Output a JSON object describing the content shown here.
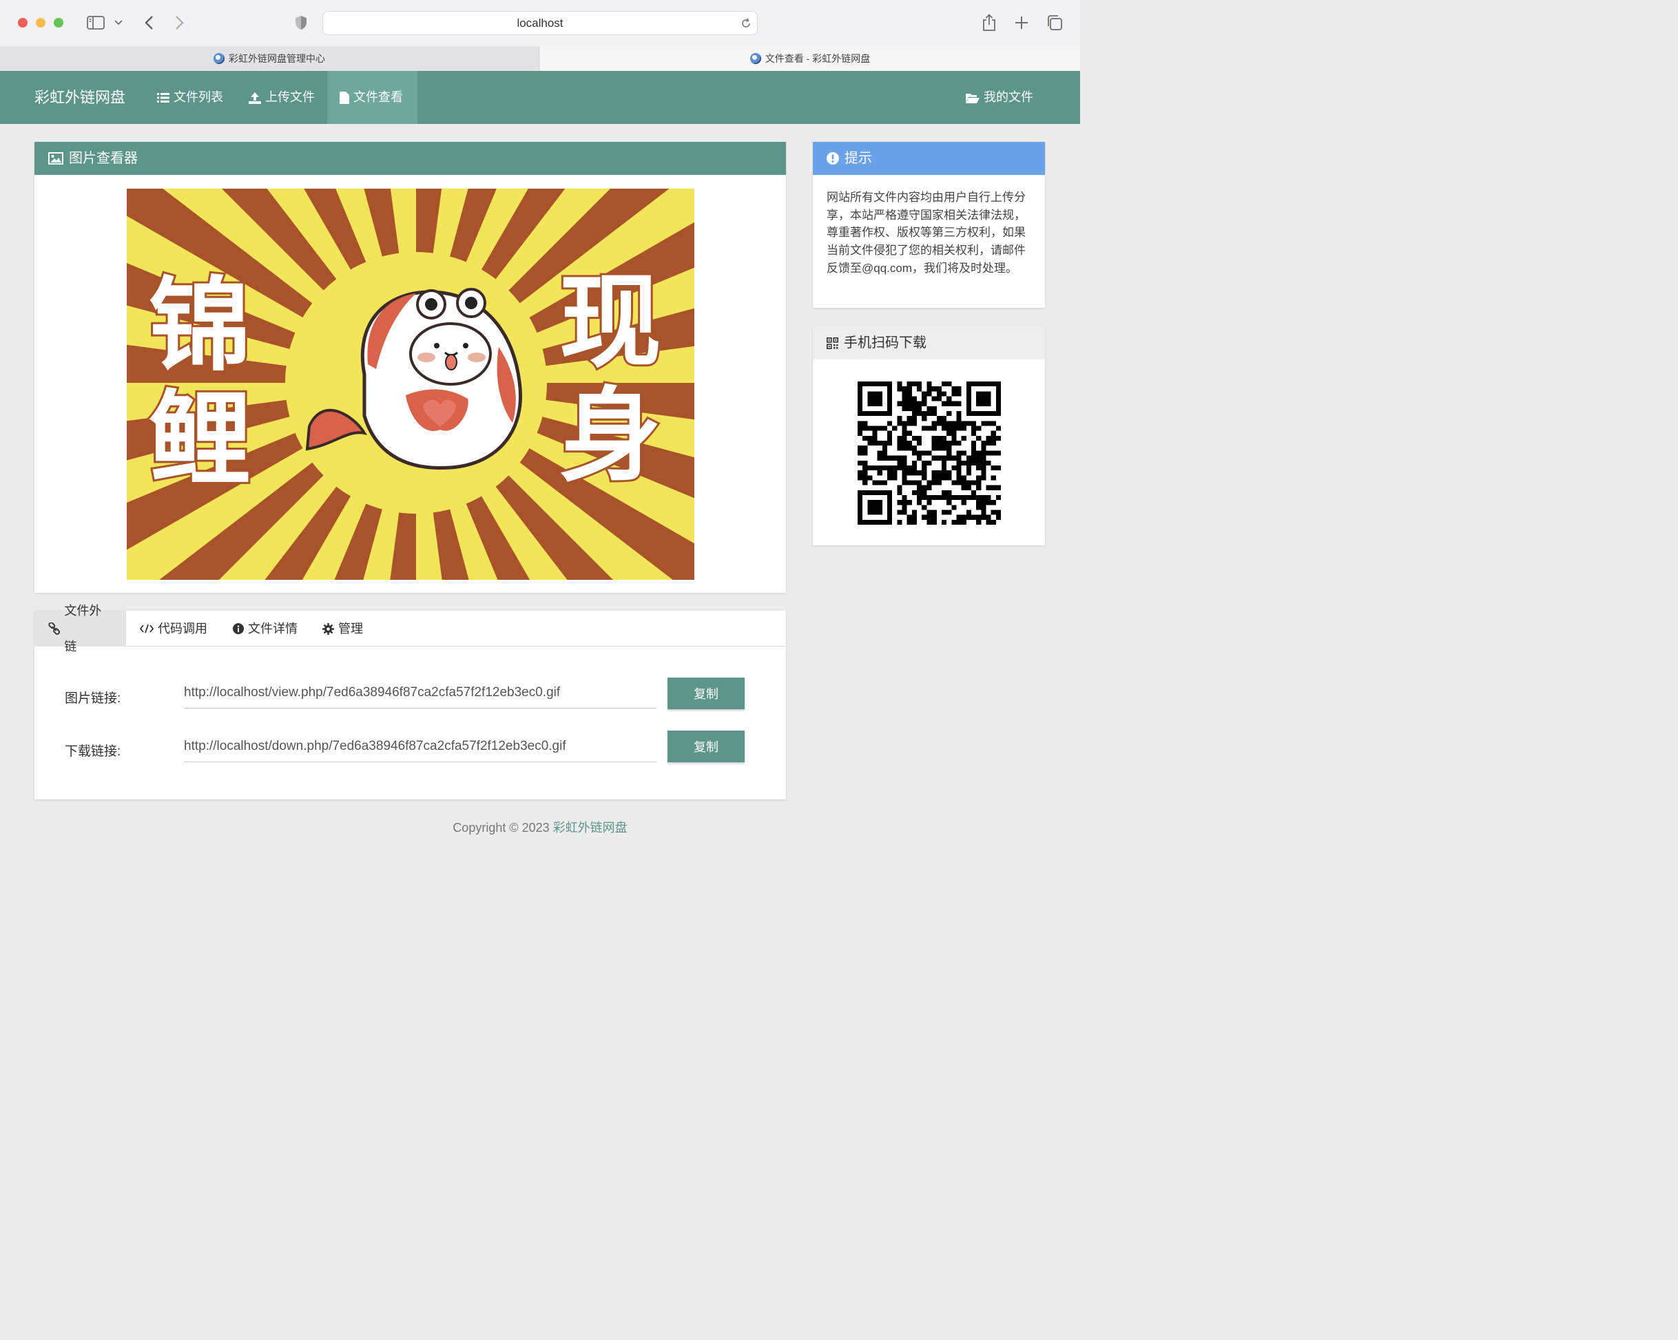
{
  "browser": {
    "url": "localhost",
    "tabs": [
      {
        "title": "彩虹外链网盘管理中心",
        "active": false
      },
      {
        "title": "文件查看 - 彩虹外链网盘",
        "active": true
      }
    ]
  },
  "navbar": {
    "brand": "彩虹外链网盘",
    "items": [
      {
        "label": "文件列表",
        "icon": "list-icon"
      },
      {
        "label": "上传文件",
        "icon": "upload-icon"
      },
      {
        "label": "文件查看",
        "icon": "file-icon",
        "active": true
      }
    ],
    "right_item": {
      "label": "我的文件",
      "icon": "folder-open-icon"
    }
  },
  "viewer": {
    "title": "图片查看器",
    "image": {
      "left_text": [
        "锦",
        "鲤"
      ],
      "right_text": [
        "现",
        "身"
      ]
    }
  },
  "links": {
    "tabs": [
      {
        "label": "文件外链",
        "icon": "link-icon",
        "active": true
      },
      {
        "label": "代码调用",
        "icon": "code-icon"
      },
      {
        "label": "文件详情",
        "icon": "info-icon"
      },
      {
        "label": "管理",
        "icon": "gear-icon"
      }
    ],
    "rows": [
      {
        "label": "图片链接:",
        "value": "http://localhost/view.php/7ed6a38946f87ca2cfa57f2f12eb3ec0.gif",
        "button": "复制"
      },
      {
        "label": "下载链接:",
        "value": "http://localhost/down.php/7ed6a38946f87ca2cfa57f2f12eb3ec0.gif",
        "button": "复制"
      }
    ]
  },
  "tip": {
    "title": "提示",
    "body": "网站所有文件内容均由用户自行上传分享，本站严格遵守国家相关法律法规，尊重著作权、版权等第三方权利，如果当前文件侵犯了您的相关权利，请邮件反馈至@qq.com，我们将及时处理。"
  },
  "qr": {
    "title": "手机扫码下载"
  },
  "footer": {
    "prefix": "Copyright © 2023 ",
    "brand": "彩虹外链网盘"
  },
  "colors": {
    "primary": "#5d958b",
    "info": "#6aa1e8",
    "image_yellow": "#f2e55a",
    "image_rust": "#a8532a"
  }
}
